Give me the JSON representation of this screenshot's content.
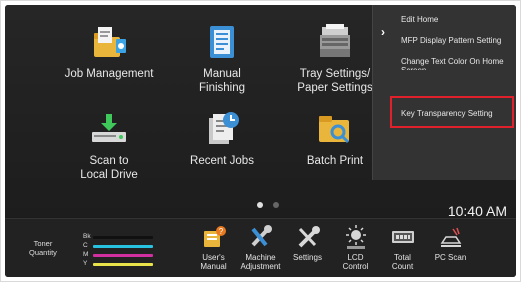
{
  "home": {
    "apps": [
      {
        "label": "Job Management",
        "icon": "job-management-icon"
      },
      {
        "label": "Manual\nFinishing",
        "icon": "manual-finishing-icon"
      },
      {
        "label": "Tray Settings/\nPaper Settings",
        "icon": "tray-settings-icon"
      },
      {
        "label": "Scan to\nLocal Drive",
        "icon": "scan-to-local-drive-icon"
      },
      {
        "label": "Recent Jobs",
        "icon": "recent-jobs-icon"
      },
      {
        "label": "Batch Print",
        "icon": "batch-print-icon"
      }
    ],
    "page_indicator": {
      "current": 1,
      "total": 2
    }
  },
  "side_menu": {
    "items": [
      "Edit Home",
      "MFP Display Pattern Setting",
      "Change Text Color On Home Screen",
      "Key Transparency Setting"
    ],
    "highlighted": "Key Transparency Setting",
    "highlight_color": "#e0202a"
  },
  "clock": "10:40 AM",
  "toner": {
    "label": "Toner\nQuantity",
    "colors": [
      {
        "code": "Bk",
        "color": "#111111"
      },
      {
        "code": "C",
        "color": "#27c3e0"
      },
      {
        "code": "M",
        "color": "#d22fa0"
      },
      {
        "code": "Y",
        "color": "#e8e34a"
      }
    ]
  },
  "bottom_bar": [
    {
      "label": "User's\nManual",
      "icon": "users-manual-icon"
    },
    {
      "label": "Machine\nAdjustment",
      "icon": "machine-adjustment-icon"
    },
    {
      "label": "Settings",
      "icon": "settings-icon"
    },
    {
      "label": "LCD\nControl",
      "icon": "lcd-control-icon"
    },
    {
      "label": "Total\nCount",
      "icon": "total-count-icon"
    },
    {
      "label": "PC Scan",
      "icon": "pc-scan-icon"
    }
  ]
}
